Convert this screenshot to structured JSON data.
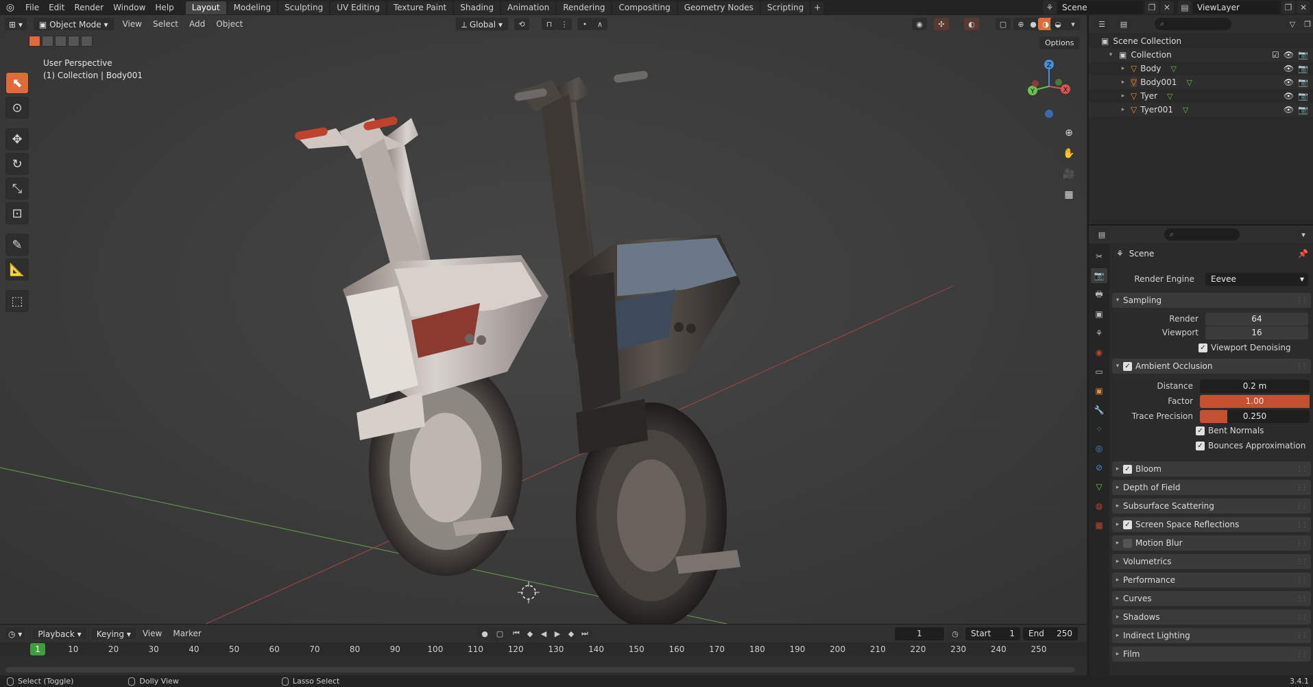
{
  "topbar": {
    "menus": [
      "File",
      "Edit",
      "Render",
      "Window",
      "Help"
    ],
    "workspace_tabs": [
      "Layout",
      "Modeling",
      "Sculpting",
      "UV Editing",
      "Texture Paint",
      "Shading",
      "Animation",
      "Rendering",
      "Compositing",
      "Geometry Nodes",
      "Scripting"
    ],
    "active_tab": "Layout",
    "scene_name": "Scene",
    "view_layer": "ViewLayer"
  },
  "viewport": {
    "mode": "Object Mode",
    "menus": [
      "View",
      "Select",
      "Add",
      "Object"
    ],
    "transform_orientation": "Global",
    "options_label": "Options",
    "overlay_line1": "User Perspective",
    "overlay_line2": "(1) Collection | Body001",
    "gizmo_axes": {
      "z": "Z",
      "y": "Y",
      "x": "X"
    }
  },
  "timeline": {
    "menus": [
      "Playback",
      "Keying",
      "View",
      "Marker"
    ],
    "current_frame": "1",
    "start_label": "Start",
    "start": "1",
    "end_label": "End",
    "end": "250",
    "ticks": [
      "1",
      "10",
      "20",
      "30",
      "40",
      "50",
      "60",
      "70",
      "80",
      "90",
      "100",
      "110",
      "120",
      "130",
      "140",
      "150",
      "160",
      "170",
      "180",
      "190",
      "200",
      "210",
      "220",
      "230",
      "240",
      "250"
    ]
  },
  "statusbar": {
    "select": "Select (Toggle)",
    "dolly": "Dolly View",
    "lasso": "Lasso Select",
    "version": "3.4.1"
  },
  "outliner": {
    "scene_collection": "Scene Collection",
    "collection": "Collection",
    "objects": [
      "Body",
      "Body001",
      "Tyer",
      "Tyer001"
    ]
  },
  "properties": {
    "context": "Scene",
    "render_engine_label": "Render Engine",
    "render_engine": "Eevee",
    "sampling": {
      "title": "Sampling",
      "render_label": "Render",
      "render": "64",
      "viewport_label": "Viewport",
      "viewport": "16",
      "denoise": "Viewport Denoising"
    },
    "ao": {
      "title": "Ambient Occlusion",
      "distance_label": "Distance",
      "distance": "0.2 m",
      "factor_label": "Factor",
      "factor": "1.00",
      "factor_fill": 1.0,
      "trace_label": "Trace Precision",
      "trace": "0.250",
      "trace_fill": 0.25,
      "bent_normals": "Bent Normals",
      "bounces": "Bounces Approximation"
    },
    "panels": [
      {
        "label": "Bloom",
        "checkbox": true,
        "checked": true
      },
      {
        "label": "Depth of Field",
        "checkbox": false
      },
      {
        "label": "Subsurface Scattering",
        "checkbox": false
      },
      {
        "label": "Screen Space Reflections",
        "checkbox": true,
        "checked": true
      },
      {
        "label": "Motion Blur",
        "checkbox": true,
        "checked": false
      },
      {
        "label": "Volumetrics",
        "checkbox": false
      },
      {
        "label": "Performance",
        "checkbox": false
      },
      {
        "label": "Curves",
        "checkbox": false
      },
      {
        "label": "Shadows",
        "checkbox": false
      },
      {
        "label": "Indirect Lighting",
        "checkbox": false
      },
      {
        "label": "Film",
        "checkbox": false
      }
    ]
  },
  "colors": {
    "accent": "#e06a3a",
    "frame_green": "#3e9e3e",
    "x_axis": "#d9534f",
    "y_axis": "#6ac24a",
    "z_axis": "#4a8fd9"
  }
}
